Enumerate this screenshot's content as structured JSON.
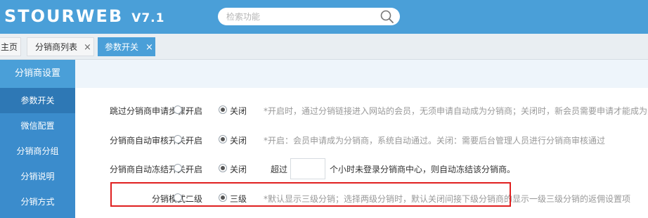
{
  "header": {
    "logo_text": "STOURWEB",
    "version": "V7.1",
    "search_placeholder": "检索功能"
  },
  "tabs": [
    {
      "label": "主页"
    },
    {
      "label": "分销商列表"
    },
    {
      "label": "参数开关"
    }
  ],
  "sidebar": {
    "title": "分销商设置",
    "items": [
      {
        "label": "参数开关"
      },
      {
        "label": "微信配置"
      },
      {
        "label": "分销商分组"
      },
      {
        "label": "分销说明"
      },
      {
        "label": "分销方式"
      }
    ]
  },
  "settings": [
    {
      "label": "跳过分销商申请步骤:",
      "opt1": "开启",
      "opt2": "关闭",
      "selected": "关闭",
      "hint": "*开启时，通过分销链接进入网站的会员，无须申请自动成为分销商；关闭时，新会员需要申请才能成为分销商"
    },
    {
      "label": "分销商自动审核开关:",
      "opt1": "开启",
      "opt2": "关闭",
      "selected": "关闭",
      "hint": "*开启：会员申请成为分销商，系统自动通过。关闭：需要后台管理人员进行分销商审核通过"
    },
    {
      "label": "分销商自动冻结开关:",
      "opt1": "开启",
      "opt2": "关闭",
      "selected": "关闭",
      "prefix": "超过",
      "hours_value": "",
      "suffix": "个小时未登录分销商中心，则自动冻结该分销商。"
    },
    {
      "label": "分销模式:",
      "opt1": "二级",
      "opt2": "三级",
      "selected": "三级",
      "hint": "*默认显示三级分销；选择两级分销时，默认关闭间接下级分销商的显示一级三级分销的返佣设置项"
    }
  ],
  "colors": {
    "header": "#4a9fd8",
    "sidebar": "#3b8ccc",
    "highlight": "#e02020"
  }
}
